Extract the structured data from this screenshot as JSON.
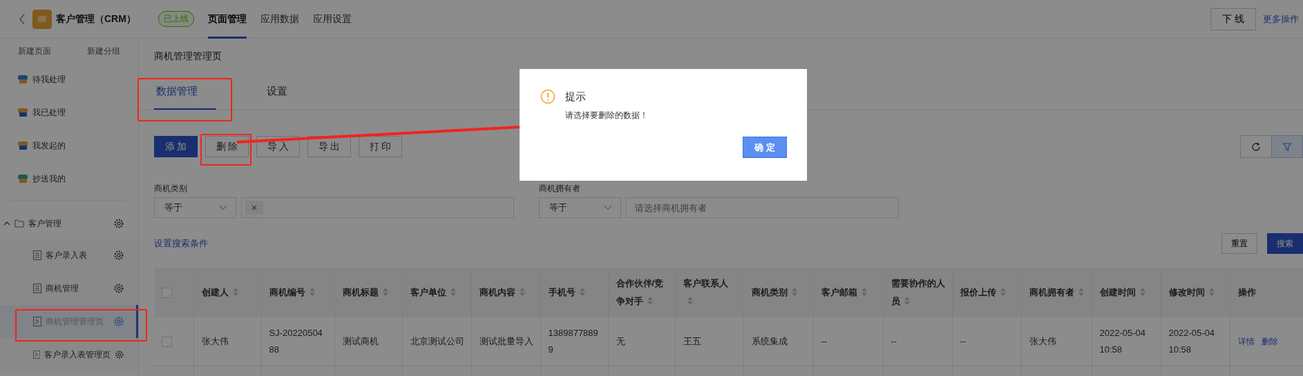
{
  "app_bar": {
    "title": "客户管理（CRM）",
    "status": "已上线",
    "nav": [
      {
        "label": "页面管理",
        "selected": true
      },
      {
        "label": "应用数据",
        "selected": false
      },
      {
        "label": "应用设置",
        "selected": false
      }
    ],
    "actions": [
      {
        "label": "下 线",
        "kind": "button"
      },
      {
        "label": "更多操作",
        "kind": "link"
      }
    ]
  },
  "sidebar": {
    "actions": [
      "新建页面",
      "新建分组"
    ],
    "shortcuts": [
      {
        "label": "待我处理",
        "kind": "todo"
      },
      {
        "label": "我已处理",
        "kind": "done"
      },
      {
        "label": "我发起的",
        "kind": "started"
      },
      {
        "label": "抄送我的",
        "kind": "cc"
      }
    ],
    "tree": [
      {
        "label": "客户管理",
        "kind": "folder",
        "expanded": true,
        "children": [
          {
            "label": "客户录入表",
            "kind": "form",
            "selected": false
          },
          {
            "label": "商机管理",
            "kind": "form",
            "selected": false
          },
          {
            "label": "商机管理管理页",
            "kind": "report",
            "selected": true
          },
          {
            "label": "客户录入表管理页",
            "kind": "report",
            "selected": false
          }
        ]
      }
    ]
  },
  "page": {
    "title": "商机管理管理页",
    "tabs": [
      {
        "label": "数据管理",
        "selected": true
      },
      {
        "label": "设置",
        "selected": false
      }
    ],
    "toolbar": [
      {
        "label": "添 加",
        "kind": "primary"
      },
      {
        "label": "删 除",
        "kind": "default"
      },
      {
        "label": "导 入",
        "kind": "default"
      },
      {
        "label": "导 出",
        "kind": "default"
      },
      {
        "label": "打 印",
        "kind": "default"
      }
    ],
    "tool_icons": [
      {
        "kind": "refresh",
        "active": false
      },
      {
        "kind": "filter",
        "active": true
      }
    ],
    "filters": [
      {
        "label": "商机类别",
        "operator": "等于",
        "kind": "tags"
      },
      {
        "label": "商机拥有者",
        "operator": "等于",
        "kind": "text",
        "placeholder": "请选择商机拥有者"
      }
    ],
    "search_settings_link": "设置搜索条件",
    "search_buttons": [
      {
        "label": "重置",
        "kind": "default"
      },
      {
        "label": "搜索",
        "kind": "primary"
      }
    ],
    "table": {
      "select_all_checked": false,
      "columns": [
        {
          "label": "创建人",
          "sortable": true
        },
        {
          "label": "商机编号",
          "sortable": true
        },
        {
          "label": "商机标题",
          "sortable": true
        },
        {
          "label": "客户单位",
          "sortable": true
        },
        {
          "label": "商机内容",
          "sortable": true
        },
        {
          "label": "手机号",
          "sortable": true
        },
        {
          "label": "合作伙伴/竞争对手",
          "sortable": true
        },
        {
          "label": "客户联系人",
          "sortable": true
        },
        {
          "label": "商机类别",
          "sortable": true
        },
        {
          "label": "客户邮箱",
          "sortable": true
        },
        {
          "label": "需要协作的人员",
          "sortable": true
        },
        {
          "label": "报价上传",
          "sortable": true
        },
        {
          "label": "商机拥有者",
          "sortable": true
        },
        {
          "label": "创建时间",
          "sortable": true
        },
        {
          "label": "修改时间",
          "sortable": true
        },
        {
          "label": "操作",
          "sortable": false
        }
      ],
      "rows": [
        {
          "checked": false,
          "cells": [
            "张大伟",
            "SJ-2022050488",
            "测试商机",
            "北京测试公司",
            "测试批量导入",
            "13898778899",
            "无",
            "王五",
            "系统集成",
            "--",
            "--",
            "--",
            "张大伟",
            "2022-05-04 10:58",
            "2022-05-04 10:58"
          ],
          "actions": [
            "详情",
            "删除"
          ]
        }
      ]
    }
  },
  "dialog": {
    "title": "提示",
    "message": "请选择要删除的数据！",
    "ok": "确 定"
  }
}
